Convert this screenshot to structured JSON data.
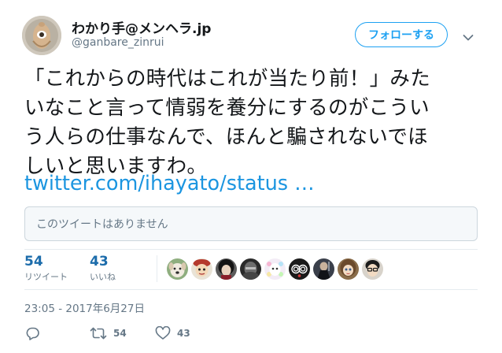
{
  "user": {
    "display_name": "わかり手@メンヘラ.jp",
    "handle": "@ganbare_zinrui"
  },
  "follow_label": "フォローする",
  "tweet": {
    "lines": [
      "「これからの時代はこれが当たり前！」みた",
      "いなこと言って情弱を養分にするのがこうい",
      "う人らの仕事なんで、ほんと騙されないでほ",
      "しいと思いますわ。"
    ],
    "link": "twitter.com/ihayato/status …"
  },
  "quoted_tweet_notice": "このツイートはありません",
  "stats": {
    "retweets": {
      "count": "54",
      "label": "リツイート"
    },
    "likes": {
      "count": "43",
      "label": "いいね"
    }
  },
  "liker_avatars": [
    "dog-face",
    "cartoon-face",
    "dark-hair-person",
    "dark-photo",
    "pastel-character",
    "spiral-eyes",
    "dark-figure",
    "doll-face",
    "glasses-face"
  ],
  "timestamp": "23:05 - 2017年6月27日",
  "actions": {
    "retweet_count": "54",
    "like_count": "43"
  },
  "colors": {
    "accent": "#1da1f2",
    "link": "#1b95e0",
    "stat_number": "#1c6cab",
    "muted": "#657786",
    "border": "#e6ecf0"
  }
}
